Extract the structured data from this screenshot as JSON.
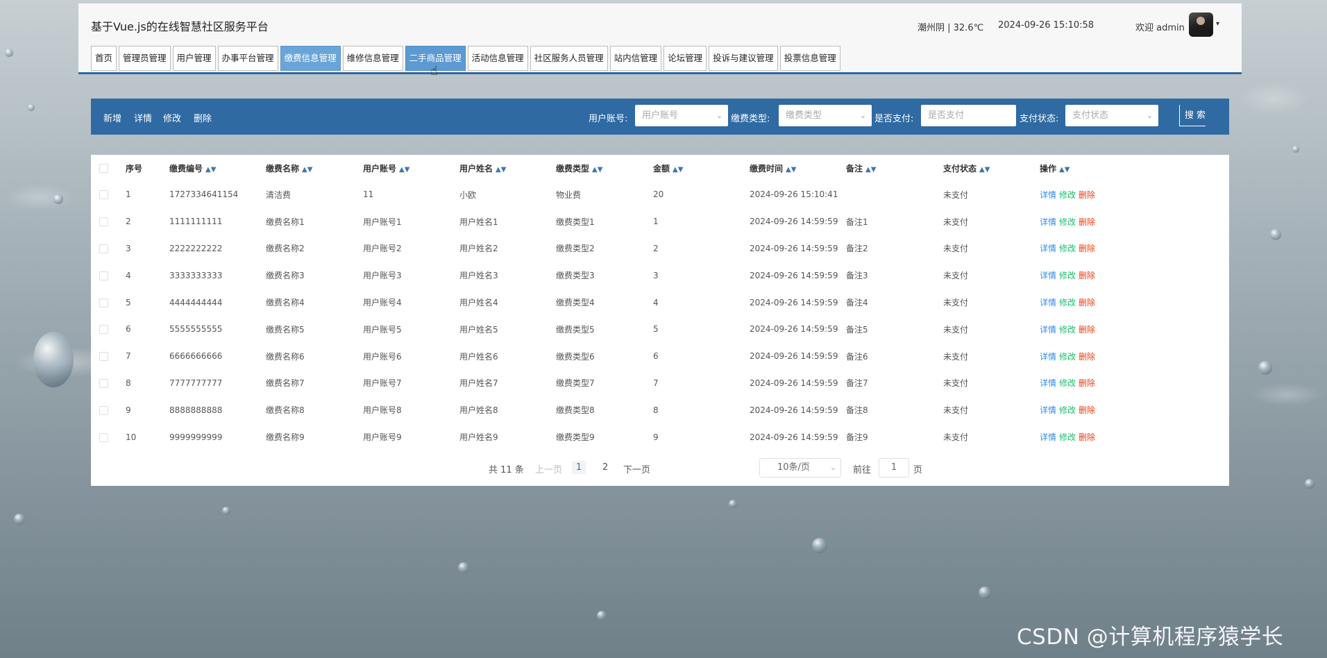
{
  "site": {
    "title": "基于Vue.js的在线智慧社区服务平台"
  },
  "header": {
    "weather": "潮州阴 | 32.6℃",
    "datetime": "2024-09-26   15:10:58",
    "welcome": "欢迎 admin",
    "caret": "▾"
  },
  "menu": [
    {
      "label": "首页"
    },
    {
      "label": "管理员管理"
    },
    {
      "label": "用户管理"
    },
    {
      "label": "办事平台管理"
    },
    {
      "label": "缴费信息管理"
    },
    {
      "label": "维修信息管理"
    },
    {
      "label": "二手商品管理"
    },
    {
      "label": "活动信息管理"
    },
    {
      "label": "社区服务人员管理"
    },
    {
      "label": "站内信管理"
    },
    {
      "label": "论坛管理"
    },
    {
      "label": "投诉与建议管理"
    },
    {
      "label": "投票信息管理"
    }
  ],
  "toolbar": {
    "add": "新增",
    "detail": "详情",
    "edit": "修改",
    "delete": "删除",
    "user_account_label": "用户账号:",
    "user_account_placeholder": "用户账号",
    "fee_type_label": "缴费类型:",
    "fee_type_placeholder": "缴费类型",
    "paid_label": "是否支付:",
    "paid_placeholder": "是否支付",
    "pay_status_label": "支付状态:",
    "pay_status_placeholder": "支付状态",
    "search": "搜 索"
  },
  "table": {
    "headers": [
      "序号",
      "缴费编号",
      "缴费名称",
      "用户账号",
      "用户姓名",
      "缴费类型",
      "金额",
      "缴费时间",
      "备注",
      "支付状态",
      "操作"
    ],
    "ops": {
      "detail": "详情",
      "edit": "修改",
      "delete": "删除"
    },
    "rows": [
      [
        "1",
        "1727334641154",
        "清洁费",
        "11",
        "小欧",
        "物业费",
        "20",
        "2024-09-26 15:10:41",
        "",
        "未支付"
      ],
      [
        "2",
        "1111111111",
        "缴费名称1",
        "用户账号1",
        "用户姓名1",
        "缴费类型1",
        "1",
        "2024-09-26 14:59:59",
        "备注1",
        "未支付"
      ],
      [
        "3",
        "2222222222",
        "缴费名称2",
        "用户账号2",
        "用户姓名2",
        "缴费类型2",
        "2",
        "2024-09-26 14:59:59",
        "备注2",
        "未支付"
      ],
      [
        "4",
        "3333333333",
        "缴费名称3",
        "用户账号3",
        "用户姓名3",
        "缴费类型3",
        "3",
        "2024-09-26 14:59:59",
        "备注3",
        "未支付"
      ],
      [
        "5",
        "4444444444",
        "缴费名称4",
        "用户账号4",
        "用户姓名4",
        "缴费类型4",
        "4",
        "2024-09-26 14:59:59",
        "备注4",
        "未支付"
      ],
      [
        "6",
        "5555555555",
        "缴费名称5",
        "用户账号5",
        "用户姓名5",
        "缴费类型5",
        "5",
        "2024-09-26 14:59:59",
        "备注5",
        "未支付"
      ],
      [
        "7",
        "6666666666",
        "缴费名称6",
        "用户账号6",
        "用户姓名6",
        "缴费类型6",
        "6",
        "2024-09-26 14:59:59",
        "备注6",
        "未支付"
      ],
      [
        "8",
        "7777777777",
        "缴费名称7",
        "用户账号7",
        "用户姓名7",
        "缴费类型7",
        "7",
        "2024-09-26 14:59:59",
        "备注7",
        "未支付"
      ],
      [
        "9",
        "8888888888",
        "缴费名称8",
        "用户账号8",
        "用户姓名8",
        "缴费类型8",
        "8",
        "2024-09-26 14:59:59",
        "备注8",
        "未支付"
      ],
      [
        "10",
        "9999999999",
        "缴费名称9",
        "用户账号9",
        "用户姓名9",
        "缴费类型9",
        "9",
        "2024-09-26 14:59:59",
        "备注9",
        "未支付"
      ]
    ]
  },
  "pagination": {
    "total": "共 11 条",
    "prev": "上一页",
    "page1": "1",
    "page2": "2",
    "next": "下一页",
    "page_size": "10条/页",
    "goto": "前往",
    "goto_value": "1",
    "page_unit": "页"
  },
  "watermark": "CSDN @计算机程序猿学长"
}
